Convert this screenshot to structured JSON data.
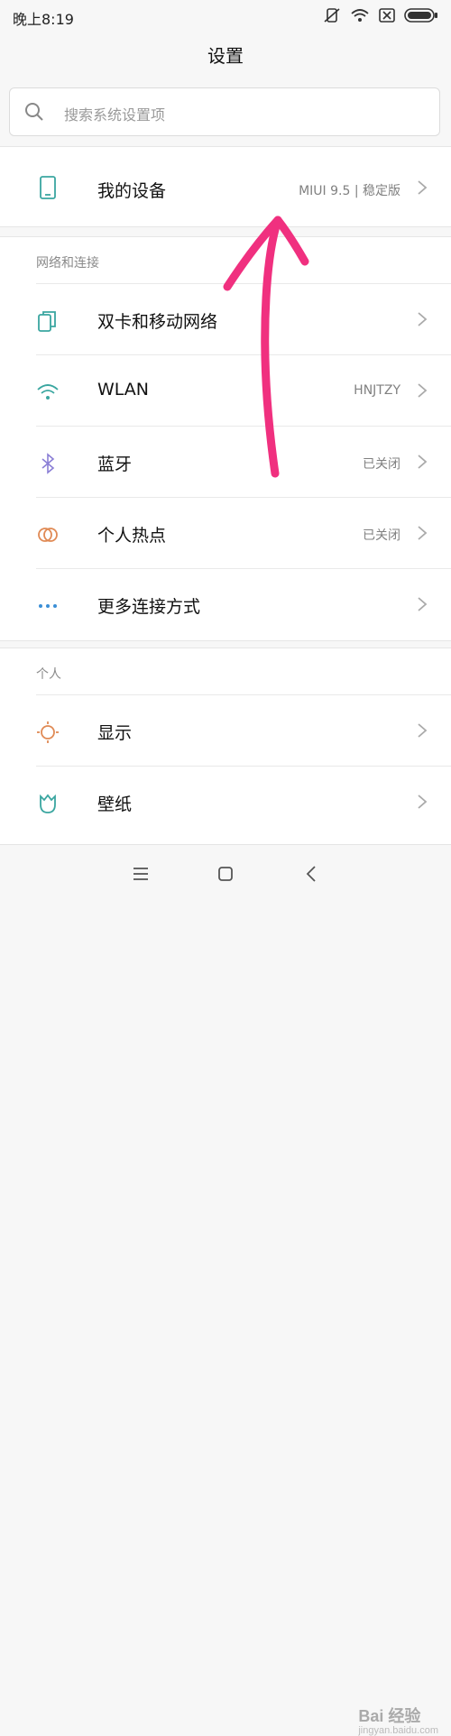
{
  "status": {
    "time": "晚上8:19"
  },
  "header": {
    "title": "设置"
  },
  "search": {
    "placeholder": "搜索系统设置项"
  },
  "device": {
    "label": "我的设备",
    "value": "MIUI 9.5 | 稳定版"
  },
  "network": {
    "heading": "网络和连接",
    "items": [
      {
        "label": "双卡和移动网络",
        "value": ""
      },
      {
        "label": "WLAN",
        "value": "HNJTZY"
      },
      {
        "label": "蓝牙",
        "value": "已关闭"
      },
      {
        "label": "个人热点",
        "value": "已关闭"
      },
      {
        "label": "更多连接方式",
        "value": ""
      }
    ]
  },
  "personal": {
    "heading": "个人",
    "items": [
      {
        "label": "显示",
        "value": ""
      },
      {
        "label": "壁纸",
        "value": ""
      }
    ]
  },
  "watermark": {
    "brand": "Bai 经验",
    "url": "jingyan.baidu.com"
  },
  "colors": {
    "annotation_arrow": "#f0307f",
    "icon_teal": "#3aa6a0",
    "icon_orange": "#e08a55"
  }
}
